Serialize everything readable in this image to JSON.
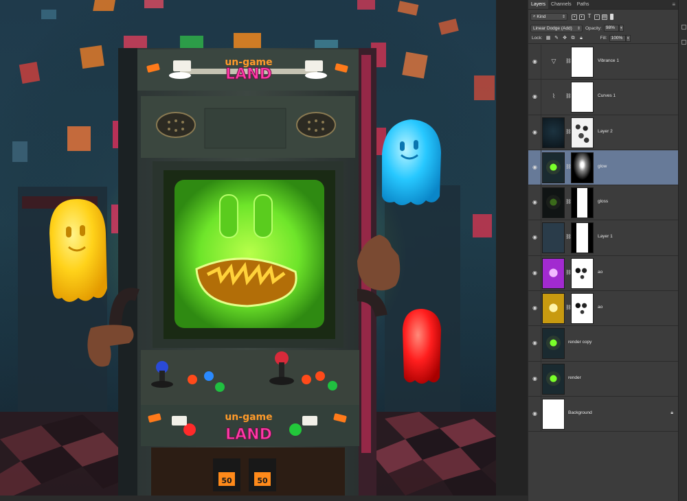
{
  "panel": {
    "tabs": [
      {
        "label": "Layers",
        "active": true
      },
      {
        "label": "Channels",
        "active": false
      },
      {
        "label": "Paths",
        "active": false
      }
    ],
    "menu_icon": "panel-menu-icon",
    "filter": {
      "kind_label": "Kind",
      "icon": "search-icon"
    },
    "blend_mode": "Linear Dodge (Add)",
    "opacity_label": "Opacity:",
    "opacity_value": "98%",
    "lock_label": "Lock:",
    "fill_label": "Fill:",
    "fill_value": "100%",
    "layers": [
      {
        "name": "Vibrance 1",
        "type": "adjustment",
        "icon": "vibrance-icon",
        "glyph": "▽",
        "mask": "white",
        "selected": false
      },
      {
        "name": "Curves 1",
        "type": "adjustment",
        "icon": "curves-icon",
        "glyph": "⌇",
        "mask": "white",
        "selected": false
      },
      {
        "name": "Layer 2",
        "type": "pixel",
        "thumb": "dark-room",
        "mask": "splotch",
        "selected": false
      },
      {
        "name": "glow",
        "type": "pixel",
        "thumb": "arcade",
        "mask": "radial-dark",
        "selected": true
      },
      {
        "name": "gloss",
        "type": "pixel",
        "thumb": "arcade-dark",
        "mask": "gloss",
        "selected": false
      },
      {
        "name": "Layer 1",
        "type": "pixel",
        "thumb": "solid-blue",
        "mask": "cabinet",
        "selected": false
      },
      {
        "name": "ao",
        "type": "pixel",
        "thumb": "purple",
        "mask": "spots",
        "selected": false
      },
      {
        "name": "ao",
        "type": "pixel",
        "thumb": "yellow",
        "mask": "spots",
        "selected": false
      },
      {
        "name": "render copy",
        "type": "pixel",
        "thumb": "arcade",
        "mask": null,
        "selected": false
      },
      {
        "name": "render",
        "type": "pixel",
        "thumb": "arcade",
        "mask": null,
        "selected": false
      },
      {
        "name": "Background",
        "type": "background",
        "thumb": "white",
        "mask": null,
        "locked": true,
        "selected": false
      }
    ]
  },
  "artwork": {
    "marquee_top": "un-game",
    "marquee_bottom": "LAND",
    "coin_left": "50",
    "coin_right": "50",
    "colors": {
      "screen": "#7cff2a",
      "ghost_yellow": "#ffd21a",
      "ghost_cyan": "#27c8ff",
      "ghost_red": "#ff1e1e",
      "selection": "#677a98"
    }
  }
}
